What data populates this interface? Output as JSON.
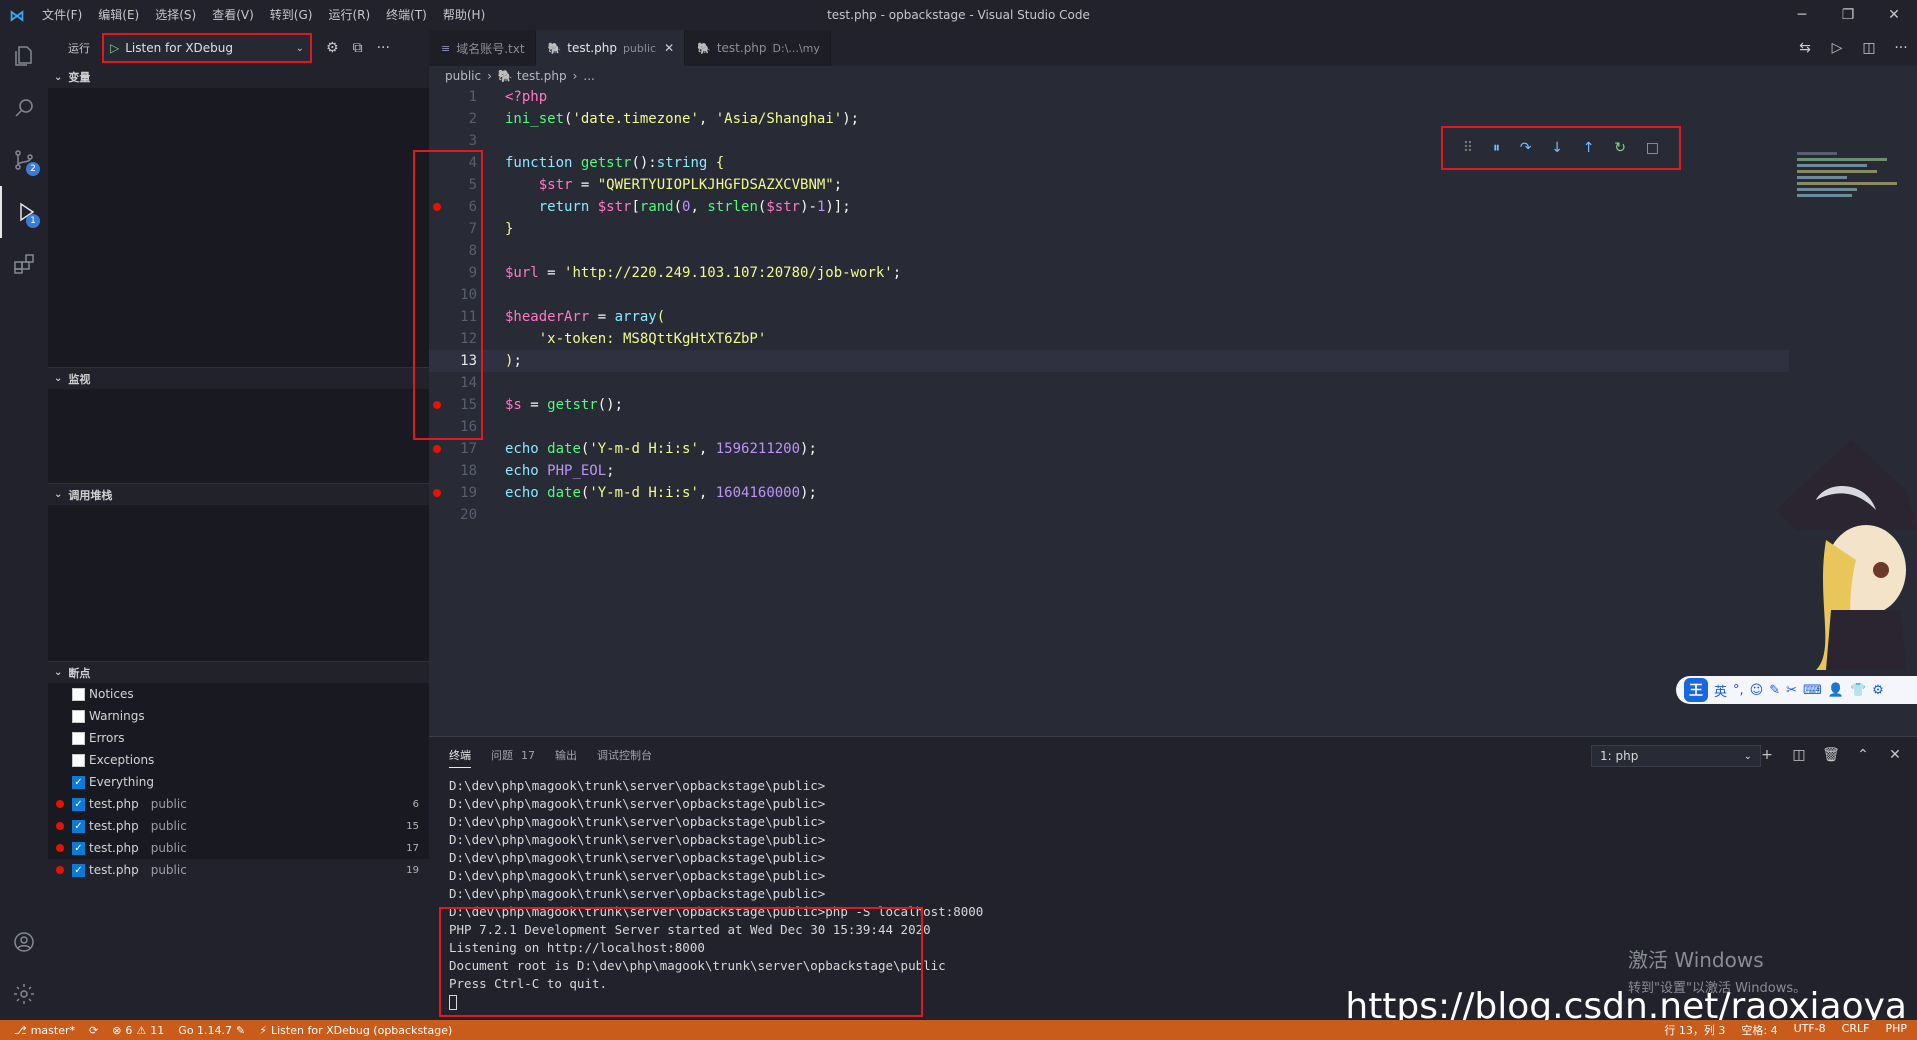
{
  "window": {
    "title": "test.php - opbackstage - Visual Studio Code",
    "menu": [
      "文件(F)",
      "编辑(E)",
      "选择(S)",
      "查看(V)",
      "转到(G)",
      "运行(R)",
      "终端(T)",
      "帮助(H)"
    ],
    "minimize": "─",
    "restore": "❐",
    "close": "✕"
  },
  "activity": {
    "scm_badge": "2",
    "debug_badge": "1"
  },
  "sidebar": {
    "run_label": "运行",
    "config_name": "Listen for XDebug",
    "sections": {
      "variables": "变量",
      "watch": "监视",
      "callstack": "调用堆栈",
      "breakpoints": "断点"
    },
    "exception_bps": [
      {
        "label": "Notices",
        "checked": false
      },
      {
        "label": "Warnings",
        "checked": false
      },
      {
        "label": "Errors",
        "checked": false
      },
      {
        "label": "Exceptions",
        "checked": false
      },
      {
        "label": "Everything",
        "checked": true
      }
    ],
    "file_bps": [
      {
        "file": "test.php",
        "path": "public",
        "line": "6"
      },
      {
        "file": "test.php",
        "path": "public",
        "line": "15"
      },
      {
        "file": "test.php",
        "path": "public",
        "line": "17"
      },
      {
        "file": "test.php",
        "path": "public",
        "line": "19"
      }
    ]
  },
  "tabs": [
    {
      "label": "域名账号.txt",
      "sub": "",
      "active": false
    },
    {
      "label": "test.php",
      "sub": "public",
      "active": true
    },
    {
      "label": "test.php",
      "sub": "D:\\...\\my",
      "active": false
    }
  ],
  "breadcrumb": {
    "folder": "public",
    "file": "test.php",
    "more": "..."
  },
  "code": {
    "current_line": 13,
    "breakpoint_lines": [
      6,
      15,
      17,
      19
    ],
    "line_numbers": [
      "1",
      "2",
      "3",
      "4",
      "5",
      "6",
      "7",
      "8",
      "9",
      "10",
      "11",
      "12",
      "13",
      "14",
      "15",
      "16",
      "17",
      "18",
      "19",
      "20"
    ]
  },
  "panel": {
    "tabs": [
      "终端",
      "问题",
      "输出",
      "调试控制台"
    ],
    "problems_count": "17",
    "terminal_select": "1: php",
    "lines": [
      "D:\\dev\\php\\magook\\trunk\\server\\opbackstage\\public>",
      "D:\\dev\\php\\magook\\trunk\\server\\opbackstage\\public>",
      "D:\\dev\\php\\magook\\trunk\\server\\opbackstage\\public>",
      "D:\\dev\\php\\magook\\trunk\\server\\opbackstage\\public>",
      "D:\\dev\\php\\magook\\trunk\\server\\opbackstage\\public>",
      "D:\\dev\\php\\magook\\trunk\\server\\opbackstage\\public>",
      "D:\\dev\\php\\magook\\trunk\\server\\opbackstage\\public>",
      "D:\\dev\\php\\magook\\trunk\\server\\opbackstage\\public>php -S localhost:8000",
      "PHP 7.2.1 Development Server started at Wed Dec 30 15:39:44 2020",
      "Listening on http://localhost:8000",
      "Document root is D:\\dev\\php\\magook\\trunk\\server\\opbackstage\\public",
      "Press Ctrl-C to quit."
    ]
  },
  "watermark": {
    "activate_title": "激活 Windows",
    "activate_sub": "转到\"设置\"以激活 Windows。",
    "blog_url": "https://blog.csdn.net/raoxiaoya"
  },
  "ime": {
    "logo": "王",
    "mode": "英"
  },
  "statusbar": {
    "branch": "master*",
    "errors": "6",
    "warnings": "11",
    "go_version": "Go 1.14.7",
    "debug_config": "Listen for XDebug (opbackstage)",
    "position": "行 13，列 3",
    "spaces": "空格: 4",
    "encoding": "UTF-8",
    "eol": "CRLF",
    "language": "PHP"
  },
  "colors": {
    "accent_status": "#c95b1b",
    "breakpoint": "#e51400",
    "highlight_box": "#e0191f"
  }
}
